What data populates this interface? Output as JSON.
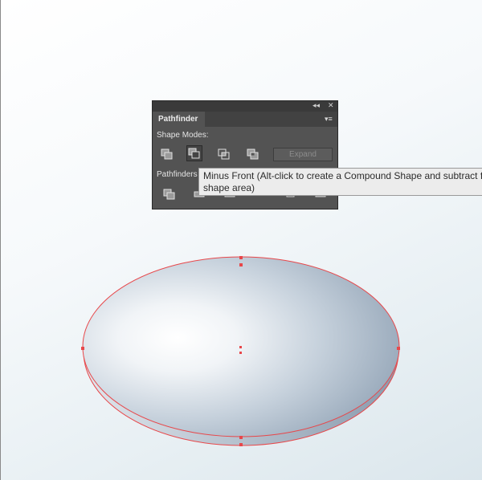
{
  "panel": {
    "topbar": {
      "collapse_glyph": "◂◂",
      "close_glyph": "✕"
    },
    "tab_label": "Pathfinder",
    "menu_glyph": "▾≡",
    "shape_modes_label": "Shape Modes:",
    "pathfinders_label": "Pathfinders",
    "expand_label": "Expand",
    "shape_mode_buttons": [
      "unite",
      "minus-front",
      "intersect",
      "exclude"
    ],
    "active_button": "minus-front"
  },
  "tooltip": {
    "line1": "Minus Front (Alt-click to create a Compound Shape and subtract f",
    "line2": "shape area)"
  },
  "colors": {
    "selection": "#e8474a",
    "panel_bg": "#535353",
    "panel_dark": "#3a3a3a"
  }
}
